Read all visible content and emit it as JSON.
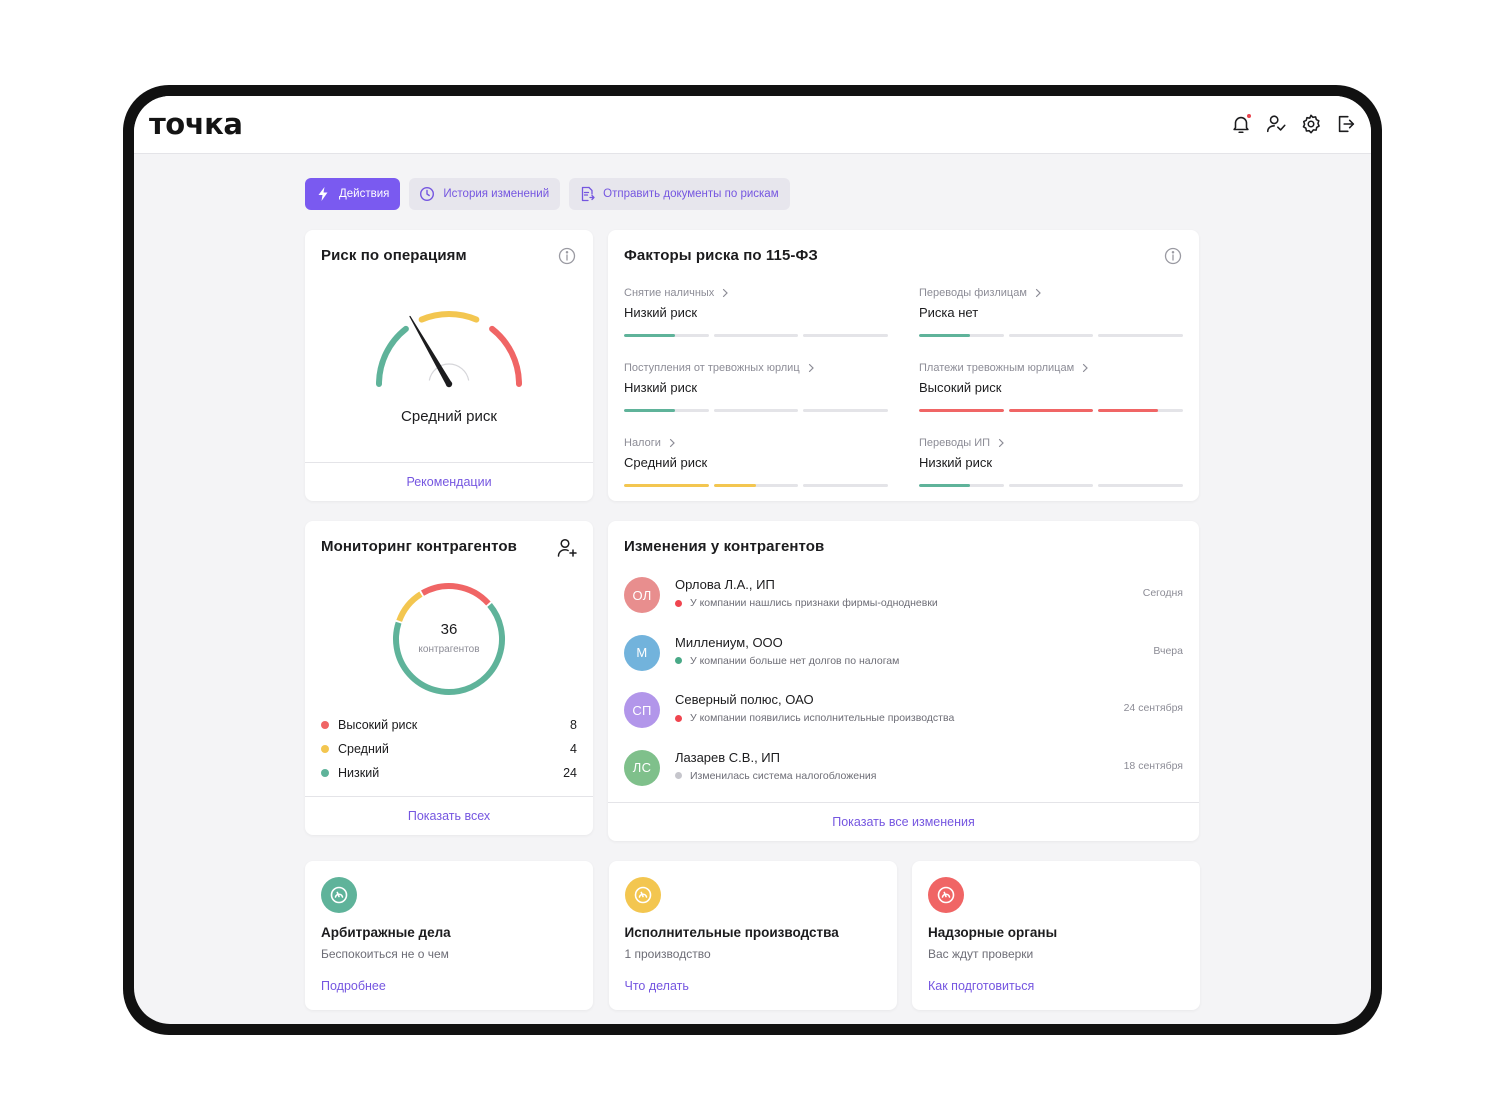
{
  "app": {
    "logo": "точка"
  },
  "topbar_icons": [
    "bell-icon",
    "user-shield-icon",
    "gear-icon",
    "logout-icon"
  ],
  "tabs": [
    {
      "label": "Действия",
      "icon": "lightning-icon",
      "active": true
    },
    {
      "label": "История изменений",
      "icon": "clock-icon",
      "active": false
    },
    {
      "label": "Отправить документы по рискам",
      "icon": "document-send-icon",
      "active": false
    }
  ],
  "risk_card": {
    "title": "Риск по операциям",
    "gauge_label": "Средний риск",
    "footer_link": "Рекомендации",
    "colors": {
      "low": "#5fb39a",
      "medium": "#f3c650",
      "high": "#f06565"
    }
  },
  "factors_card": {
    "title": "Факторы риска по 115-ФЗ",
    "items": [
      {
        "name": "Снятие наличных",
        "value": "Низкий риск",
        "level": 0.2,
        "color": "#5fb39a"
      },
      {
        "name": "Переводы физлицам",
        "value": "Риска нет",
        "level": 0.2,
        "color": "#5fb39a"
      },
      {
        "name": "Поступления от тревожных юрлиц",
        "value": "Низкий риск",
        "level": 0.2,
        "color": "#5fb39a"
      },
      {
        "name": "Платежи тревожным юрлицам",
        "value": "Высокий риск",
        "level": 0.9,
        "color": "#f06565"
      },
      {
        "name": "Налоги",
        "value": "Средний риск",
        "level": 0.5,
        "color": "#f3c650"
      },
      {
        "name": "Переводы ИП",
        "value": "Низкий риск",
        "level": 0.2,
        "color": "#5fb39a"
      }
    ]
  },
  "monitor_card": {
    "title": "Мониторинг контрагентов",
    "total": "36",
    "total_label": "контрагентов",
    "legend": [
      {
        "label": "Высокий риск",
        "count": "8",
        "color": "#f06565"
      },
      {
        "label": "Средний",
        "count": "4",
        "color": "#f3c650"
      },
      {
        "label": "Низкий",
        "count": "24",
        "color": "#5fb39a"
      }
    ],
    "footer_link": "Показать всех"
  },
  "changes_card": {
    "title": "Изменения у контрагентов",
    "items": [
      {
        "initials": "ОЛ",
        "avatar_color": "#e88e8e",
        "name": "Орлова Л.А., ИП",
        "desc": "У компании нашлись признаки фирмы-однодневки",
        "dot_color": "#f0454f",
        "date": "Сегодня"
      },
      {
        "initials": "М",
        "avatar_color": "#72b3dc",
        "name": "Миллениум, ООО",
        "desc": "У компании больше нет долгов по налогам",
        "dot_color": "#49a987",
        "date": "Вчера"
      },
      {
        "initials": "СП",
        "avatar_color": "#b296ea",
        "name": "Северный полюс, ОАО",
        "desc": "У компании появились исполнительные производства",
        "dot_color": "#f0454f",
        "date": "24 сентября"
      },
      {
        "initials": "ЛС",
        "avatar_color": "#7fc08b",
        "name": "Лазарев С.В., ИП",
        "desc": "Изменилась система налогобложения",
        "dot_color": "#c6c6cc",
        "date": "18 сентября"
      }
    ],
    "footer_link": "Показать все изменения"
  },
  "bottom_cards": [
    {
      "title": "Арбитражные дела",
      "sub": "Беспокоиться не о чем",
      "link": "Подробнее",
      "icon_color": "#5fb39a",
      "icon": "gauge-icon"
    },
    {
      "title": "Исполнительные производства",
      "sub": "1 производство",
      "link": "Что делать",
      "icon_color": "#f3c650",
      "icon": "gauge-icon"
    },
    {
      "title": "Надзорные органы",
      "sub": "Вас ждут проверки",
      "link": "Как подготовиться",
      "icon_color": "#f06565",
      "icon": "gauge-icon"
    }
  ]
}
